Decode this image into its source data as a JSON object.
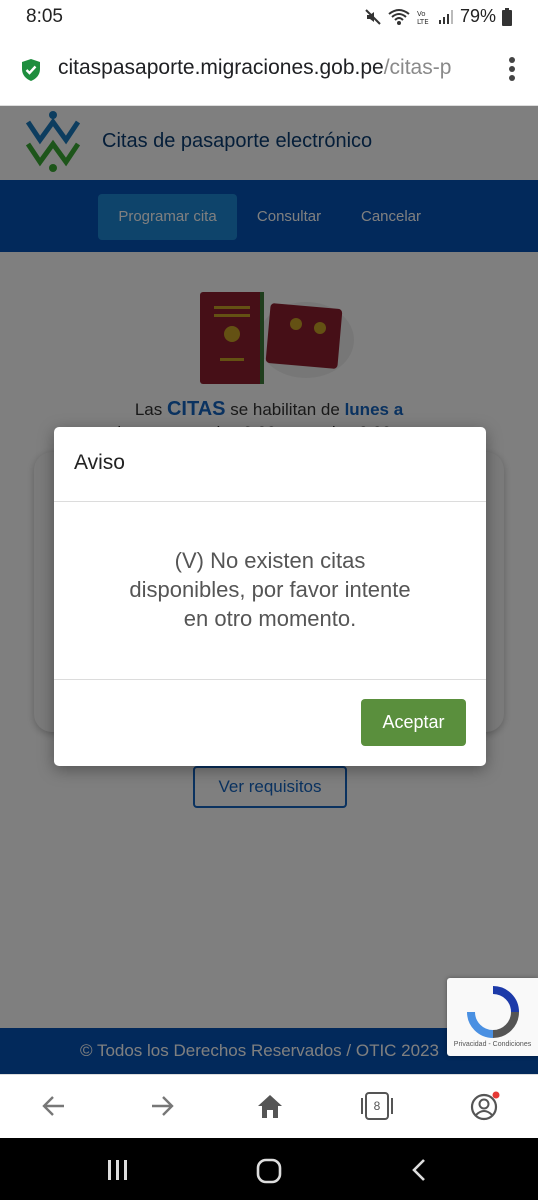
{
  "status": {
    "time": "8:05",
    "battery": "79%"
  },
  "browser": {
    "url_main": "citaspasaporte.migraciones.gob.pe",
    "url_dim": "/citas-p",
    "tab_count": "8"
  },
  "site": {
    "title": "Citas de pasaporte electrónico",
    "nav": [
      "Programar cita",
      "Consultar",
      "Cancelar"
    ],
    "info_text_1": "Las ",
    "info_big": "CITAS",
    "info_text_2": " se habilitan de ",
    "info_blue": "lunes a",
    "info_line2": "viernes, entre las 8:00 a.m. y las 6:00 p.m.",
    "requirements_button": "Ver requisitos",
    "footer": "© Todos los Derechos Reservados / OTIC 2023",
    "recaptcha_text": "Privacidad - Condiciones"
  },
  "modal": {
    "title": "Aviso",
    "message": "(V) No existen citas disponibles, por favor intente en otro momento.",
    "ok_label": "Aceptar"
  },
  "colors": {
    "nav_blue": "#0553b7",
    "accent_green": "#5a8f3d",
    "title_blue": "#0a3d73"
  }
}
